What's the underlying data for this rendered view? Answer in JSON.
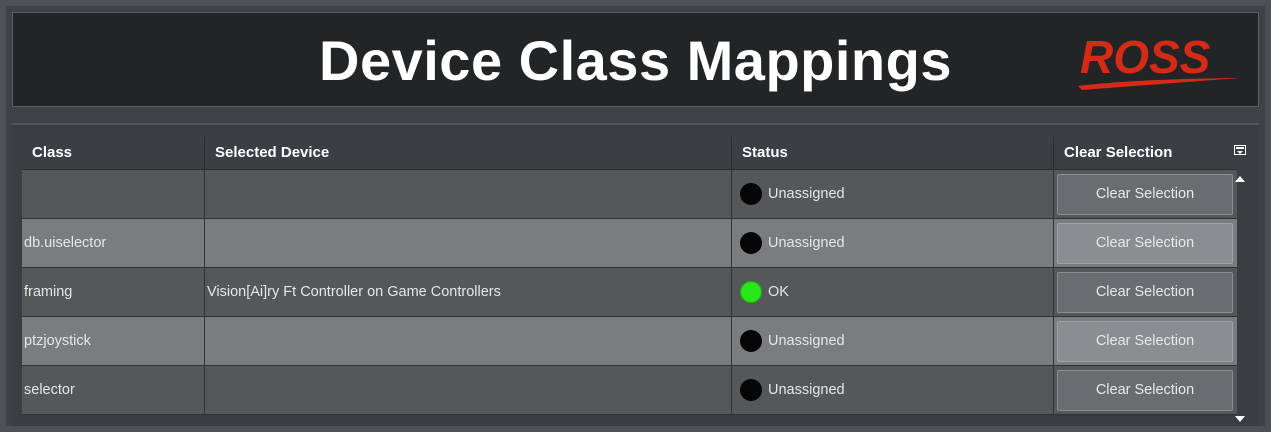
{
  "header": {
    "title": "Device Class Mappings",
    "logo_text": "ROSS",
    "logo_color": "#d42a16"
  },
  "table": {
    "columns": [
      "Class",
      "Selected Device",
      "Status",
      "Clear Selection"
    ],
    "rows": [
      {
        "class": "",
        "device": "",
        "status": "Unassigned",
        "status_color": "#050505",
        "button": "Clear Selection"
      },
      {
        "class": "db.uiselector",
        "device": "",
        "status": "Unassigned",
        "status_color": "#050505",
        "button": "Clear Selection"
      },
      {
        "class": "framing",
        "device": "Vision[Ai]ry Ft Controller on Game Controllers",
        "status": "OK",
        "status_color": "#27e619",
        "button": "Clear Selection"
      },
      {
        "class": "ptzjoystick",
        "device": "",
        "status": "Unassigned",
        "status_color": "#050505",
        "button": "Clear Selection"
      },
      {
        "class": "selector",
        "device": "",
        "status": "Unassigned",
        "status_color": "#050505",
        "button": "Clear Selection"
      }
    ]
  },
  "scrollbar": {
    "column_menu_icon": "column-menu-icon",
    "up_icon": "arrow-up-icon",
    "down_icon": "arrow-down-icon"
  }
}
